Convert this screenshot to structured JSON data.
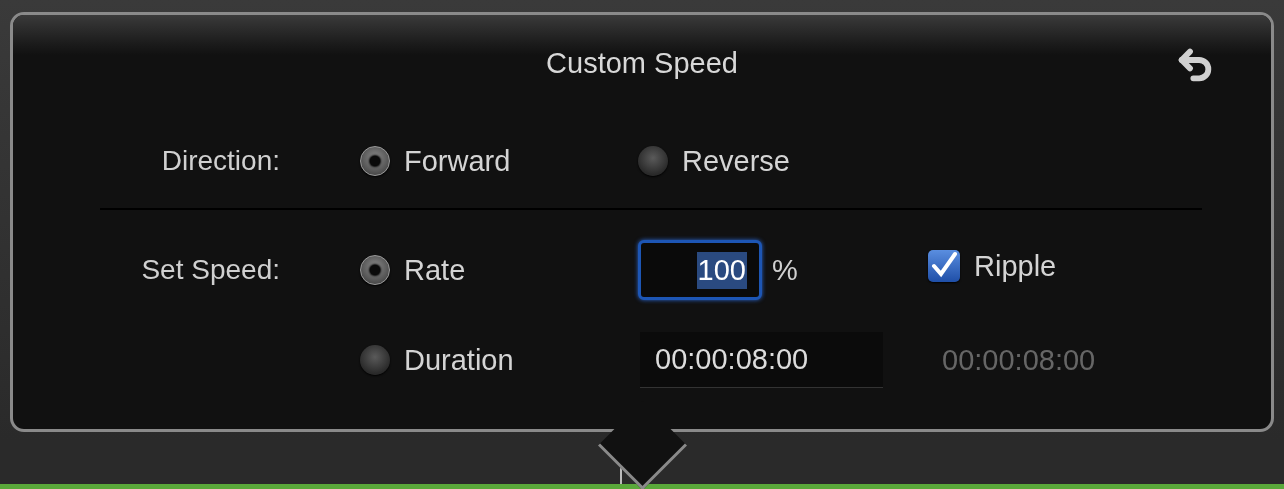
{
  "title": "Custom Speed",
  "direction": {
    "label": "Direction:",
    "options": [
      {
        "label": "Forward",
        "selected": true
      },
      {
        "label": "Reverse",
        "selected": false
      }
    ]
  },
  "set_speed": {
    "label": "Set Speed:",
    "options": [
      {
        "label": "Rate",
        "selected": true
      },
      {
        "label": "Duration",
        "selected": false
      }
    ],
    "rate_field": {
      "value": "100"
    },
    "rate_unit": "%",
    "ripple": {
      "label": "Ripple",
      "checked": true
    },
    "duration_field": {
      "value": "00:00:08:00"
    },
    "duration_result": "00:00:08:00"
  }
}
